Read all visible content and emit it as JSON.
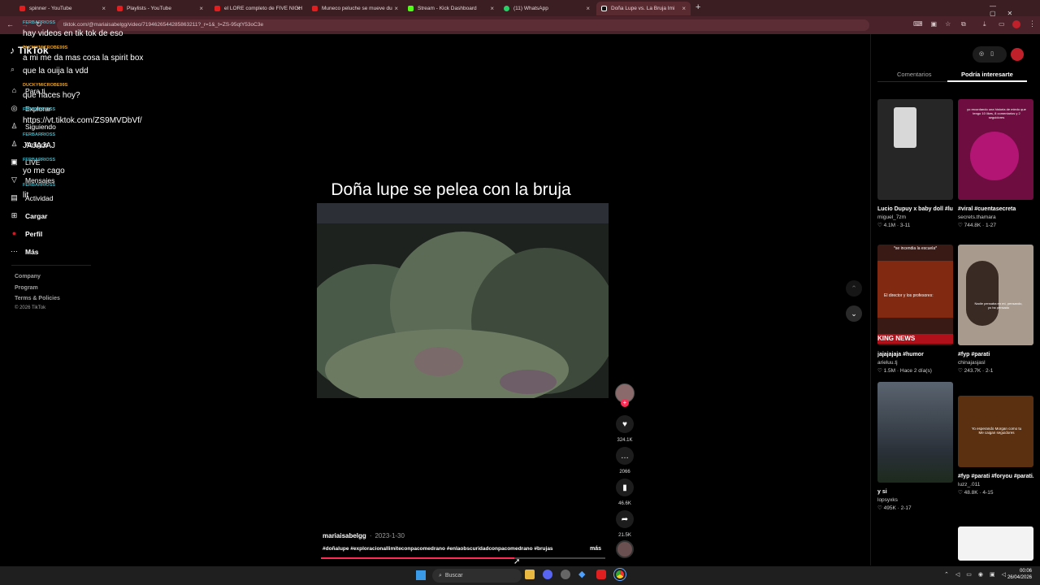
{
  "browser": {
    "tabs": [
      {
        "label": "spinner - YouTube",
        "color": "#e02020"
      },
      {
        "label": "Playlists - YouTube",
        "color": "#e02020"
      },
      {
        "label": "el LORE completo de FIVE NIGH",
        "color": "#e02020"
      },
      {
        "label": "Muneco peluche se mueve du",
        "color": "#e02020"
      },
      {
        "label": "Stream - Kick Dashboard",
        "color": "#53fc18"
      },
      {
        "label": "(11) WhatsApp",
        "color": "#25d366"
      },
      {
        "label": "Doña Lupe vs. La Bruja Imi",
        "color": "#ffffff"
      }
    ],
    "new_tab": "+",
    "url": "tiktok.com/@mariaisabelgg/video/7194626544285863211?_r=1&_t=ZS-95qtY53oC3e"
  },
  "sidebar": {
    "logo": "TikTok",
    "nav": [
      {
        "label": "Para ti",
        "icon": "home-icon",
        "glyph": "⌂"
      },
      {
        "label": "Explorar",
        "icon": "compass-icon",
        "glyph": "◎"
      },
      {
        "label": "Siguiendo",
        "icon": "user-icon",
        "glyph": "♙"
      },
      {
        "label": "Amigos",
        "icon": "friends-icon",
        "glyph": "♙"
      },
      {
        "label": "LIVE",
        "icon": "live-icon",
        "glyph": "▣"
      },
      {
        "label": "Mensajes",
        "icon": "send-icon",
        "glyph": "▽"
      },
      {
        "label": "Actividad",
        "icon": "inbox-icon",
        "glyph": "▤"
      },
      {
        "label": "Cargar",
        "icon": "upload-icon",
        "glyph": "⊞"
      },
      {
        "label": "Perfil",
        "icon": "avatar-icon",
        "glyph": "●"
      },
      {
        "label": "Más",
        "icon": "more-icon",
        "glyph": "···"
      }
    ],
    "footer": [
      "Company",
      "Program",
      "Terms & Policies",
      "© 2026 TikTok"
    ]
  },
  "chat": [
    {
      "user": "FERBARRIOSS",
      "user_color": "#3fb6c7",
      "message": "hay videos en tik tok de eso"
    },
    {
      "user": "DUCKYMICROBE99S",
      "user_color": "#e0a030",
      "message": "a mi me da mas cosa la spirit box"
    },
    {
      "user": "",
      "user_color": "#e0a030",
      "message": "que la ouija la vdd"
    },
    {
      "user": "DUCKYMICROBE99S",
      "user_color": "#e0a030",
      "message": "que haces hoy?"
    },
    {
      "user": "FERBARRIOSS",
      "user_color": "#3fb6c7",
      "message": "https://vt.tiktok.com/ZS9MVDbVf/"
    },
    {
      "user": "FERBARRIOSS",
      "user_color": "#3fb6c7",
      "message": "JAJAJAJ"
    },
    {
      "user": "FERBARRIOSS",
      "user_color": "#3fb6c7",
      "message": "yo me cago"
    },
    {
      "user": "FERBARRIOSS",
      "user_color": "#3fb6c7",
      "message": "lit"
    }
  ],
  "video": {
    "title": "Doña lupe se pelea con la bruja",
    "author": "mariaisabelgg",
    "date": "2023-1-30",
    "caption": "#doñalupe #exploracionallimiteconpacomedrano #enlaobscuridadconpacomedrano #brujas",
    "more": "más",
    "progress": 0.68
  },
  "actions": [
    {
      "name": "like",
      "icon": "heart-icon",
      "glyph": "♥",
      "count": "324.1K"
    },
    {
      "name": "comment",
      "icon": "comment-icon",
      "glyph": "…",
      "count": "2066"
    },
    {
      "name": "save",
      "icon": "bookmark-icon",
      "glyph": "▮",
      "count": "46.6K"
    },
    {
      "name": "share",
      "icon": "share-icon",
      "glyph": "➦",
      "count": "21.5K"
    }
  ],
  "right_panel": {
    "tabs": [
      "Comentarios",
      "Podría interesarte"
    ],
    "active_tab": 1,
    "cards": [
      {
        "title": "Lucio Dupuy x baby doll #luciodupuy #fyp...",
        "user": "miguel_7zm",
        "views": "4.1M",
        "date": "3-11",
        "bg": "#2a2a2a"
      },
      {
        "title": "#viral #cuentasecreta",
        "user": "secrets.thamara",
        "views": "744.8K",
        "date": "1-27",
        "bg": "#8a1450",
        "overlay": "yo recordando una historia de miedo que tengo 10 likes, 8 comentarios y 2 seguidores"
      },
      {
        "title": "jajajajaja #humor",
        "user": "arieluu.tj",
        "views": "1.5M",
        "date": "Hace 2 día(s)",
        "bg": "#3a1a14",
        "overlay": "*se incendia la escuela*",
        "overlay2": "El director y los profesores:",
        "banner": "KING NEWS"
      },
      {
        "title": "#fyp #parati",
        "user": "chinajasjasl",
        "views": "243.7K",
        "date": "2-1",
        "bg": "#b8a89a",
        "overlay": "Nadie pensaba en mí, pensando, yo ha pensado"
      },
      {
        "title": "y si",
        "user": "lopsyxks",
        "views": "495K",
        "date": "2-17",
        "bg": "#4a5560"
      },
      {
        "title": "#fyp #parati #foryou #parati...",
        "user": "luzz_.011",
        "views": "48.8K",
        "date": "4-15",
        "bg": "#5a3010",
        "overlay": "Yo esperando Morgan como tu Me caigan seguidores"
      }
    ]
  },
  "taskbar": {
    "search": "Buscar",
    "time": "00:06",
    "date": "26/04/2026"
  }
}
